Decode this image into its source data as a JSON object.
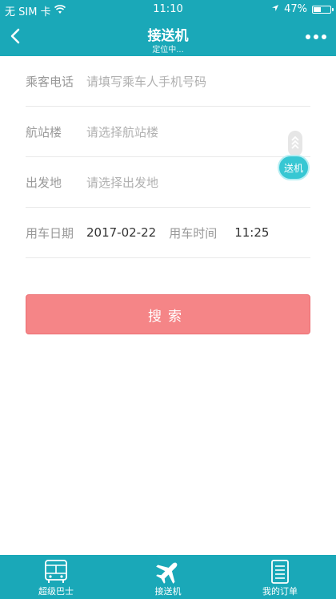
{
  "status_bar": {
    "carrier": "无 SIM 卡",
    "time": "11:10",
    "battery": "47%",
    "battery_level": 0.47
  },
  "nav": {
    "title": "接送机",
    "subtitle": "定位中..."
  },
  "form": {
    "phone": {
      "label": "乘客电话",
      "placeholder": "请填写乘车人手机号码"
    },
    "terminal": {
      "label": "航站楼",
      "placeholder": "请选择航站楼"
    },
    "departure": {
      "label": "出发地",
      "placeholder": "请选择出发地"
    },
    "date": {
      "label": "用车日期",
      "value": "2017-02-22"
    },
    "time": {
      "label": "用车时间",
      "value": "11:25"
    }
  },
  "side_button": {
    "label": "送机"
  },
  "search_button": {
    "label": "搜索"
  },
  "tabs": [
    {
      "label": "超级巴士",
      "icon": "bus-icon"
    },
    {
      "label": "接送机",
      "icon": "plane-icon"
    },
    {
      "label": "我的订单",
      "icon": "order-list-icon"
    }
  ],
  "colors": {
    "primary": "#1aa8b8",
    "search_button": "#f58587",
    "side_button": "#37c7d3"
  }
}
